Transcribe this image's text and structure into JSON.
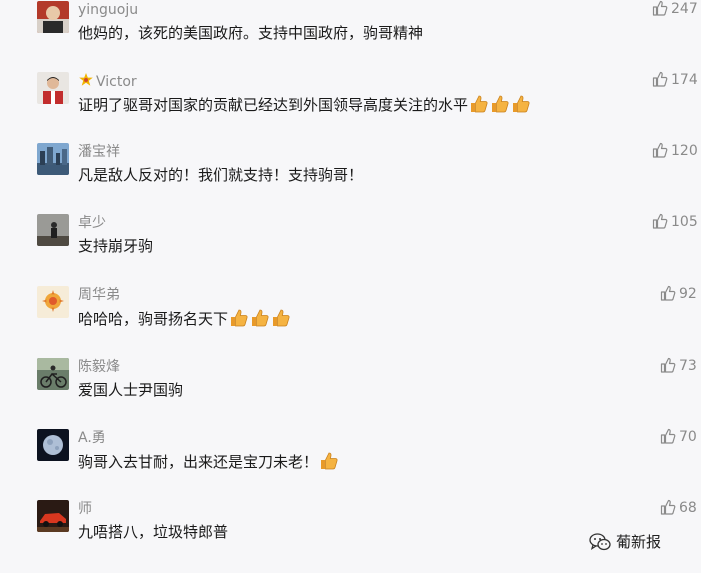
{
  "comments": [
    {
      "name": "yinguoju",
      "text": "他妈的，该死的美国政府。支持中国政府，驹哥精神",
      "likes": "247",
      "thumbs_emoji": 0,
      "vip": false,
      "avatar": "avatar-icon"
    },
    {
      "name": "Victor",
      "text": "证明了驱哥对国家的贡献已经达到外国领导高度关注的水平",
      "likes": "174",
      "thumbs_emoji": 3,
      "vip": true,
      "avatar": "avatar-icon"
    },
    {
      "name": "潘宝祥",
      "text": "凡是敌人反对的！我们就支持！支持驹哥！",
      "likes": "120",
      "thumbs_emoji": 0,
      "vip": false,
      "avatar": "avatar-icon"
    },
    {
      "name": "卓少",
      "text": "支持崩牙驹",
      "likes": "105",
      "thumbs_emoji": 0,
      "vip": false,
      "avatar": "avatar-icon"
    },
    {
      "name": "周华弟",
      "text": "哈哈哈，驹哥扬名天下",
      "likes": "92",
      "thumbs_emoji": 3,
      "vip": false,
      "avatar": "avatar-icon"
    },
    {
      "name": "陈毅烽",
      "text": "爱国人士尹国驹",
      "likes": "73",
      "thumbs_emoji": 0,
      "vip": false,
      "avatar": "avatar-icon"
    },
    {
      "name": "A.勇",
      "text": "驹哥入去甘耐，出来还是宝刀未老！",
      "likes": "70",
      "thumbs_emoji": 1,
      "vip": false,
      "avatar": "avatar-icon"
    },
    {
      "name": "师",
      "text": "九唔搭八，垃圾特郎普",
      "likes": "68",
      "thumbs_emoji": 0,
      "vip": false,
      "avatar": "avatar-icon"
    }
  ],
  "watermark": {
    "label": "葡新报",
    "icon": "wechat-icon"
  },
  "colors": {
    "background": "#f7f7f9",
    "name": "#8a8a8a",
    "text": "#1a1a1a",
    "like": "#8a8a8a",
    "emoji": "#f5b342"
  }
}
